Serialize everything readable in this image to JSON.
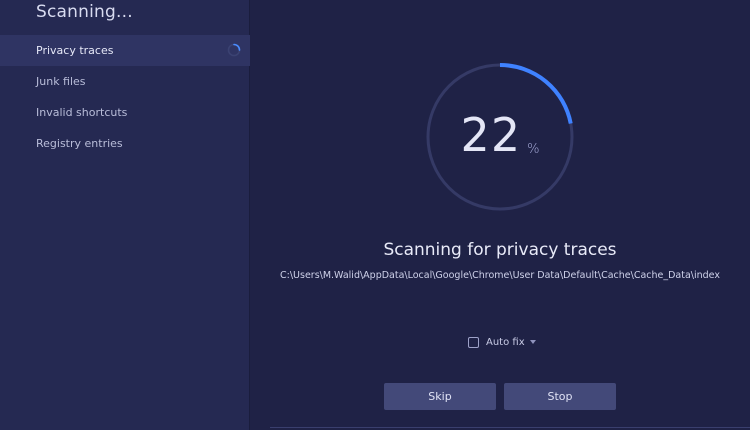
{
  "sidebar": {
    "title": "Scanning...",
    "items": [
      {
        "label": "Privacy traces",
        "active": true
      },
      {
        "label": "Junk files"
      },
      {
        "label": "Invalid shortcuts"
      },
      {
        "label": "Registry entries"
      }
    ]
  },
  "progress": {
    "value": "22",
    "unit": "%",
    "fraction": 0.22
  },
  "status": {
    "title": "Scanning for privacy traces",
    "path": "C:\\Users\\M.Walid\\AppData\\Local\\Google\\Chrome\\User Data\\Default\\Cache\\Cache_Data\\index"
  },
  "autofix": {
    "label": "Auto fix",
    "checked": false
  },
  "buttons": {
    "skip": "Skip",
    "stop": "Stop"
  },
  "colors": {
    "background": "#1f2246",
    "sidebar": "#252952",
    "accent": "#3f82ff",
    "ring_track": "#353a66",
    "button": "#434979"
  },
  "icons": {
    "spinner": "spinner-icon",
    "caret": "chevron-down-icon"
  }
}
